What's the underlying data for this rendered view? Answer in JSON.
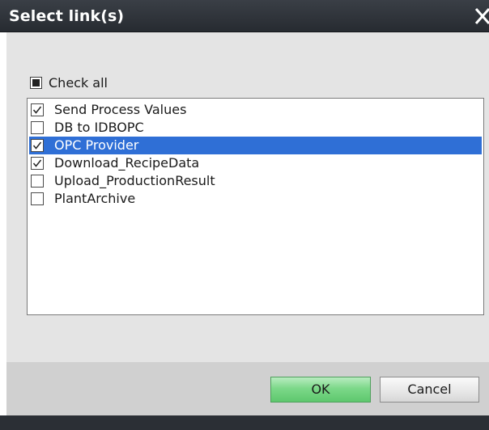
{
  "dialog": {
    "title": "Select link(s)",
    "close_icon": "close-x-icon"
  },
  "check_all": {
    "label": "Check all",
    "state": "indeterminate"
  },
  "links": [
    {
      "label": "Send Process Values",
      "checked": true,
      "selected": false
    },
    {
      "label": "DB to IDBOPC",
      "checked": false,
      "selected": false
    },
    {
      "label": "OPC Provider",
      "checked": true,
      "selected": true
    },
    {
      "label": "Download_RecipeData",
      "checked": true,
      "selected": false
    },
    {
      "label": "Upload_ProductionResult",
      "checked": false,
      "selected": false
    },
    {
      "label": "PlantArchive",
      "checked": false,
      "selected": false
    }
  ],
  "buttons": {
    "ok_label": "OK",
    "cancel_label": "Cancel"
  },
  "colors": {
    "titlebar": "#2f343b",
    "selection": "#2f6fd6",
    "ok_button": "#7cd889",
    "body_background": "#e4e4e4"
  }
}
